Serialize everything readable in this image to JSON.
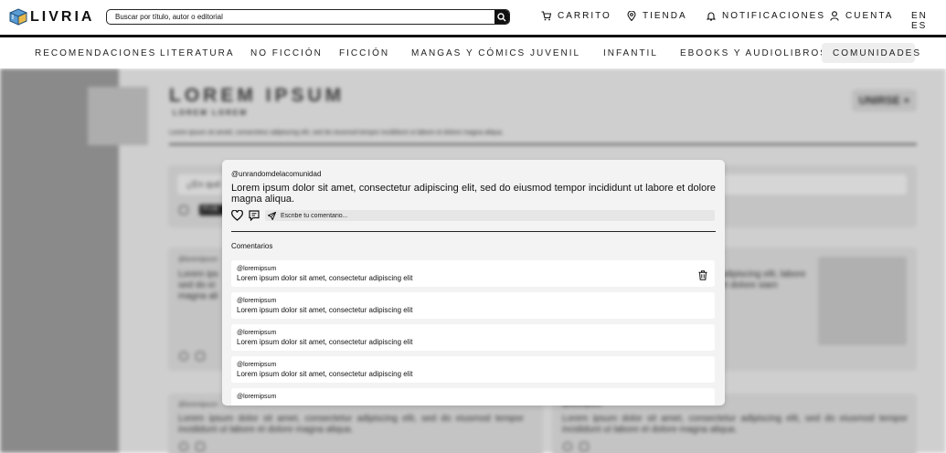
{
  "header": {
    "brand": "LIVRIA",
    "search_placeholder": "Buscar por título, autor o editorial",
    "nav": [
      {
        "label": "CARRITO",
        "icon": "cart-icon"
      },
      {
        "label": "TIENDA",
        "icon": "location-pin-icon"
      },
      {
        "label": "NOTIFICACIONES",
        "icon": "bell-icon"
      },
      {
        "label": "CUENTA",
        "icon": "user-icon"
      }
    ],
    "language": "EN ES"
  },
  "categories": [
    "RECOMENDACIONES",
    "LITERATURA",
    "NO FICCIÓN",
    "FICCIÓN",
    "MANGAS Y CÓMICS",
    "JUVENIL",
    "INFANTIL",
    "EBOOKS Y AUDIOLIBROS"
  ],
  "active_category": "COMUNIDADES",
  "community": {
    "title": "LOREM IPSUM",
    "subtitle": "LOREM    LOREM",
    "description": "Lorem ipsum sit amett, consectetur adipiscing elit, sed do eiusmod tempor incididunt ut labore et dolore magna aliqua.",
    "join_label": "UNIRSE +",
    "composer_placeholder": "¿En qué",
    "publish_label": "PUB",
    "feed": [
      {
        "user": "@loremipsum",
        "text": "Lorem ips sed do ei magna ali"
      },
      {
        "user": "",
        "text": "adipiscing elit, labore et dolore siam"
      },
      {
        "user": "@loremipsum",
        "text": "Lorem ipsum dolor sit amet, consectetur adipiscing elit, sed do eiusmod tempor incididunt ut labore et dolore magna aliqua."
      },
      {
        "user": "@loremipsum",
        "text": "Lorem ipsum dolor sit amet, consectetur adipiscing elit, sed do eiusmod tempor incididunt ut labore et dolore magna aliqua."
      }
    ]
  },
  "modal": {
    "user": "@unrandomdelacomunidad",
    "post_text": "Lorem ipsum dolor sit amet, consectetur adipiscing elit, sed do eiusmod tempor incididunt ut labore et dolore magna aliqua.",
    "comment_placeholder": "Escribe tu comentario...",
    "comments_heading": "Comentarios",
    "comments": [
      {
        "user": "@loremipsum",
        "text": "Lorem ipsum dolor sit amet, consectetur adipiscing elit"
      },
      {
        "user": "@loremipsum",
        "text": "Lorem ipsum dolor sit amet, consectetur adipiscing elit"
      },
      {
        "user": "@loremipsum",
        "text": "Lorem ipsum dolor sit amet, consectetur adipiscing elit"
      },
      {
        "user": "@loremipsum",
        "text": "Lorem ipsum dolor sit amet, consectetur adipiscing elit"
      },
      {
        "user": "@loremipsum",
        "text": ""
      }
    ]
  }
}
